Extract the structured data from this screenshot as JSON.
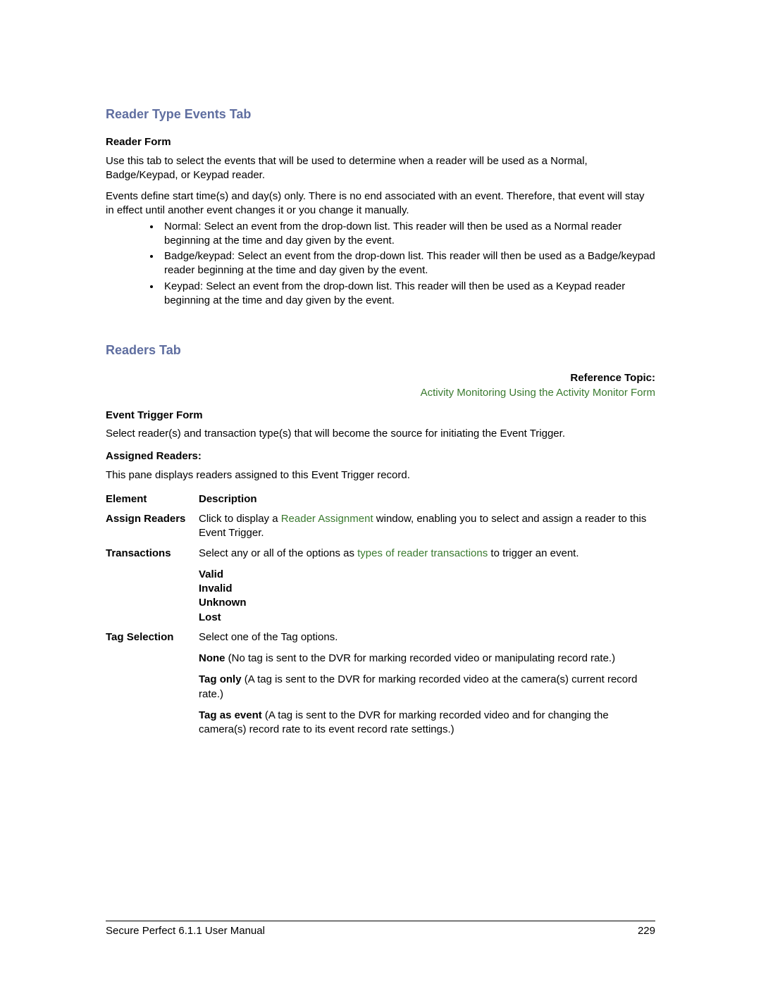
{
  "section1": {
    "heading": "Reader Type Events Tab",
    "subheading": "Reader Form",
    "intro": "Use this tab to select the events that will be used to determine when a reader will be used as a Normal, Badge/Keypad, or Keypad reader.",
    "events_para": "Events define start time(s) and day(s) only. There is no end associated with an event. Therefore, that event will stay in effect until another event changes it or you change it manually.",
    "bullets": [
      "Normal: Select an event from the drop-down list. This reader will then be used as a Normal reader beginning at the time and day given by the event.",
      "Badge/keypad: Select an event from the drop-down list. This reader will then be used as a Badge/keypad reader beginning at the time and day given by the event.",
      "Keypad: Select an event from the drop-down list. This reader will then be used as a Keypad reader beginning at the time and day given by the event."
    ]
  },
  "section2": {
    "heading": "Readers Tab",
    "reference_label": "Reference Topic:",
    "reference_link": "Activity Monitoring Using the Activity Monitor Form",
    "form_heading": "Event Trigger Form",
    "form_para": "Select reader(s) and transaction type(s) that will become the source for initiating the Event Trigger.",
    "assigned_heading": "Assigned Readers:",
    "assigned_para": "This pane displays readers assigned to this Event Trigger record.",
    "header_element": "Element",
    "header_description": "Description",
    "rows": {
      "assign_label": "Assign Readers",
      "assign_desc_pre": "Click to display a ",
      "assign_desc_link": "Reader Assignment",
      "assign_desc_post": " window, enabling you to select and assign a reader to this Event Trigger.",
      "trans_label": "Transactions",
      "trans_desc_pre": "Select any or all of the options as ",
      "trans_desc_link": "types of reader transactions",
      "trans_desc_post": " to trigger an event.",
      "trans_opt_valid": "Valid",
      "trans_opt_invalid": "Invalid",
      "trans_opt_unknown": "Unknown",
      "trans_opt_lost": "Lost",
      "tag_label": "Tag Selection",
      "tag_intro": "Select one of the Tag options.",
      "tag_none_b": "None",
      "tag_none_rest": " (No tag is sent to the DVR for marking recorded video or manipulating record rate.)",
      "tag_only_b": "Tag only",
      "tag_only_rest": " (A tag is sent to the DVR for marking recorded video at the camera(s) current record rate.)",
      "tag_event_b": "Tag as event",
      "tag_event_rest": " (A tag is sent to the DVR for marking recorded video and for changing the camera(s) record rate to its event record rate settings.)"
    }
  },
  "footer": {
    "left": "Secure Perfect 6.1.1 User Manual",
    "right": "229"
  }
}
